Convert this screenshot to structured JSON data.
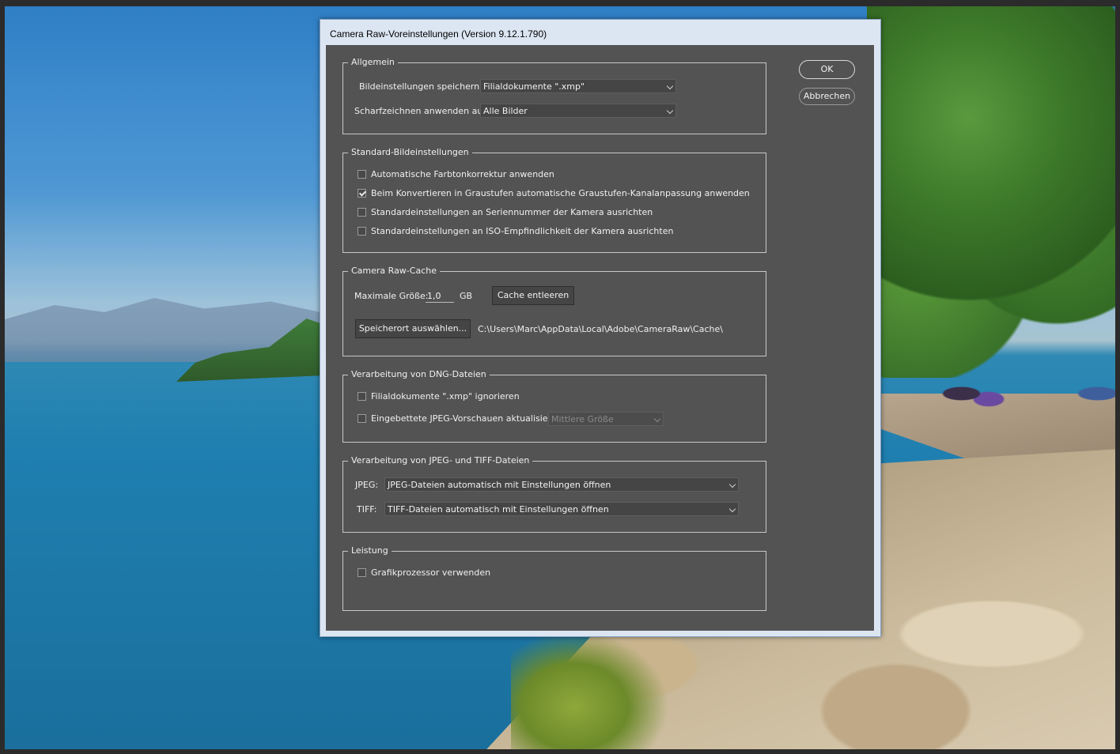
{
  "dialog": {
    "title": "Camera Raw-Voreinstellungen  (Version 9.12.1.790)",
    "ok_label": "OK",
    "cancel_label": "Abbrechen"
  },
  "allgemein": {
    "legend": "Allgemein",
    "save_label": "Bildeinstellungen speichern in:",
    "save_value": "Filialdokumente \".xmp\"",
    "sharpen_label": "Scharfzeichnen anwenden auf:",
    "sharpen_value": "Alle Bilder"
  },
  "standard": {
    "legend": "Standard-Bildeinstellungen",
    "options": [
      {
        "label": "Automatische Farbtonkorrektur anwenden",
        "checked": false
      },
      {
        "label": "Beim Konvertieren in Graustufen automatische Graustufen-Kanalanpassung anwenden",
        "checked": true
      },
      {
        "label": "Standardeinstellungen an Seriennummer der Kamera ausrichten",
        "checked": false
      },
      {
        "label": "Standardeinstellungen an ISO-Empfindlichkeit der Kamera ausrichten",
        "checked": false
      }
    ]
  },
  "cache": {
    "legend": "Camera Raw-Cache",
    "size_label": "Maximale Größe:",
    "size_value": "1,0",
    "unit": "GB",
    "purge_label": "Cache entleeren",
    "location_button": "Speicherort auswählen...",
    "path": "C:\\Users\\Marc\\AppData\\Local\\Adobe\\CameraRaw\\Cache\\"
  },
  "dng": {
    "legend": "Verarbeitung von DNG-Dateien",
    "ignore_label": "Filialdokumente \".xmp\" ignorieren",
    "ignore_checked": false,
    "update_label": "Eingebettete JPEG-Vorschauen aktualisieren:",
    "update_checked": false,
    "size_value": "Mittlere Größe"
  },
  "jpeg_tiff": {
    "legend": "Verarbeitung von JPEG- und TIFF-Dateien",
    "jpeg_label": "JPEG:",
    "jpeg_value": "JPEG-Dateien automatisch mit Einstellungen öffnen",
    "tiff_label": "TIFF:",
    "tiff_value": "TIFF-Dateien automatisch mit Einstellungen öffnen"
  },
  "performance": {
    "legend": "Leistung",
    "gpu_label": "Grafikprozessor verwenden",
    "gpu_checked": false
  }
}
